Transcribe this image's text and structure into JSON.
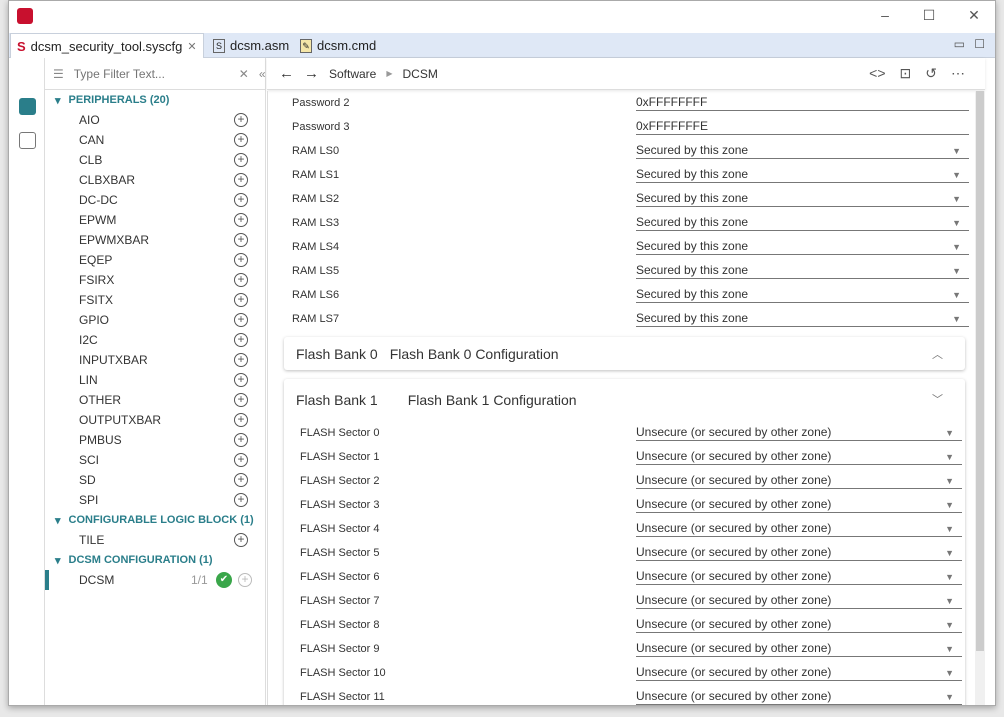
{
  "tabs": [
    {
      "label": "dcsm_security_tool.syscfg",
      "icon": "syscfg-icon"
    },
    {
      "label": "dcsm.asm",
      "icon": "asm-file-icon"
    },
    {
      "label": "dcsm.cmd",
      "icon": "cmd-file-icon"
    }
  ],
  "filter": {
    "placeholder": "Type Filter Text..."
  },
  "groups": [
    {
      "label": "PERIPHERALS (20)",
      "items": [
        "AIO",
        "CAN",
        "CLB",
        "CLBXBAR",
        "DC-DC",
        "EPWM",
        "EPWMXBAR",
        "EQEP",
        "FSIRX",
        "FSITX",
        "GPIO",
        "I2C",
        "INPUTXBAR",
        "LIN",
        "OTHER",
        "OUTPUTXBAR",
        "PMBUS",
        "SCI",
        "SD",
        "SPI"
      ]
    },
    {
      "label": "CONFIGURABLE LOGIC BLOCK (1)",
      "items": [
        "TILE"
      ]
    },
    {
      "label": "DCSM CONFIGURATION (1)",
      "items": [
        "DCSM"
      ]
    }
  ],
  "dcsm_count": "1/1",
  "breadcrumb": [
    "Software",
    "DCSM"
  ],
  "fields": [
    {
      "label": "Password 2",
      "value": "0xFFFFFFFF"
    },
    {
      "label": "Password 3",
      "value": "0xFFFFFFFE"
    },
    {
      "label": "RAM LS0",
      "value": "Secured by this zone"
    },
    {
      "label": "RAM LS1",
      "value": "Secured by this zone"
    },
    {
      "label": "RAM LS2",
      "value": "Secured by this zone"
    },
    {
      "label": "RAM LS3",
      "value": "Secured by this zone"
    },
    {
      "label": "RAM LS4",
      "value": "Secured by this zone"
    },
    {
      "label": "RAM LS5",
      "value": "Secured by this zone"
    },
    {
      "label": "RAM LS6",
      "value": "Secured by this zone"
    },
    {
      "label": "RAM LS7",
      "value": "Secured by this zone"
    }
  ],
  "bank0": {
    "name": "Flash Bank 0",
    "title": "Flash Bank 0 Configuration"
  },
  "bank1": {
    "name": "Flash Bank 1",
    "title": "Flash Bank 1 Configuration",
    "sectors": [
      {
        "label": "FLASH Sector 0",
        "value": "Unsecure (or secured by other zone)"
      },
      {
        "label": "FLASH Sector 1",
        "value": "Unsecure (or secured by other zone)"
      },
      {
        "label": "FLASH Sector 2",
        "value": "Unsecure (or secured by other zone)"
      },
      {
        "label": "FLASH Sector 3",
        "value": "Unsecure (or secured by other zone)"
      },
      {
        "label": "FLASH Sector 4",
        "value": "Unsecure (or secured by other zone)"
      },
      {
        "label": "FLASH Sector 5",
        "value": "Unsecure (or secured by other zone)"
      },
      {
        "label": "FLASH Sector 6",
        "value": "Unsecure (or secured by other zone)"
      },
      {
        "label": "FLASH Sector 7",
        "value": "Unsecure (or secured by other zone)"
      },
      {
        "label": "FLASH Sector 8",
        "value": "Unsecure (or secured by other zone)"
      },
      {
        "label": "FLASH Sector 9",
        "value": "Unsecure (or secured by other zone)"
      },
      {
        "label": "FLASH Sector 10",
        "value": "Unsecure (or secured by other zone)"
      },
      {
        "label": "FLASH Sector 11",
        "value": "Unsecure (or secured by other zone)"
      }
    ]
  }
}
